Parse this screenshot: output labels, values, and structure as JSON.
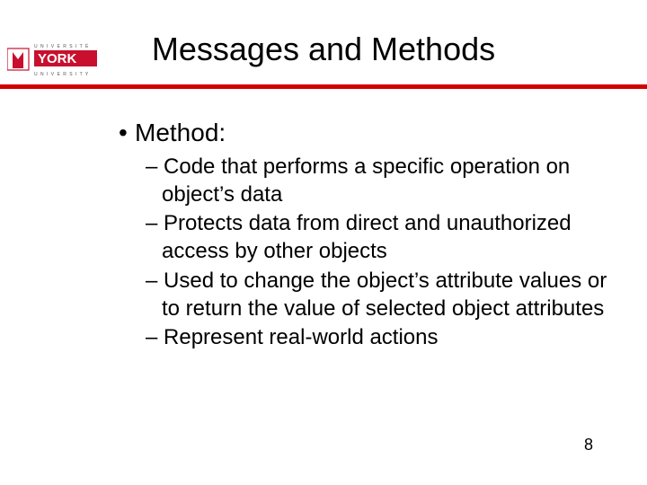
{
  "logo": {
    "university_label": "U N I V E R S I T É",
    "york": "YORK",
    "university_label2": "U N I V E R S I T Y"
  },
  "title": "Messages and Methods",
  "content": {
    "lvl1": {
      "bullet": "•",
      "text": "Method:"
    },
    "lvl2": [
      {
        "dash": "–",
        "text": "Code that performs a specific operation on object’s data"
      },
      {
        "dash": "–",
        "text": "Protects data from direct and unauthorized access by other objects"
      },
      {
        "dash": "–",
        "text": "Used to change the object’s attribute values or to return the value of selected object attributes"
      },
      {
        "dash": "–",
        "text": "Represent real-world actions"
      }
    ]
  },
  "page_number": "8",
  "colors": {
    "rule": "#d40000",
    "york_red": "#c8102e"
  }
}
